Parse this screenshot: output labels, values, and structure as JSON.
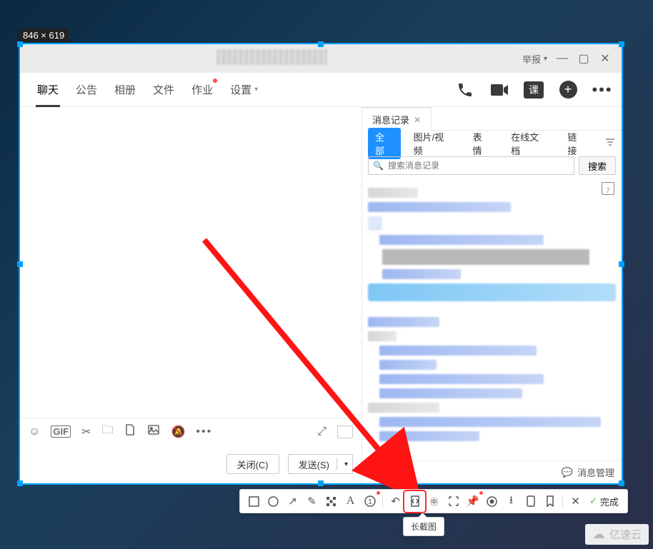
{
  "dimensions": "846 × 619",
  "titlebar": {
    "report": "举报"
  },
  "tabs": {
    "chat": "聊天",
    "notice": "公告",
    "album": "相册",
    "file": "文件",
    "homework": "作业",
    "settings": "设置"
  },
  "input_toolbar": {},
  "close_btn": "关闭(C)",
  "send_btn": "发送(S)",
  "side_tab": {
    "history": "消息记录"
  },
  "filters": {
    "all": "全部",
    "media": "图片/视频",
    "emoji": "表情",
    "doc": "在线文档",
    "link": "链接"
  },
  "search": {
    "placeholder": "搜索消息记录",
    "btn": "搜索"
  },
  "calendar_day": "7",
  "msg_mgr": "消息管理",
  "tool_done": "完成",
  "bubble": "长截图",
  "watermark": "亿速云"
}
